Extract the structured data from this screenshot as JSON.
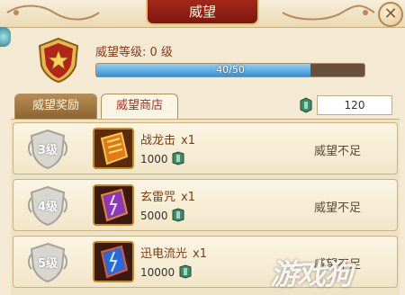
{
  "window": {
    "title": "威望"
  },
  "reputation": {
    "level_label": "威望等级:",
    "level_value": "0 级",
    "progress_text": "40/50",
    "progress_current": 40,
    "progress_max": 50
  },
  "tabs": [
    {
      "label": "威望奖励",
      "active": false
    },
    {
      "label": "威望商店",
      "active": true
    }
  ],
  "currency": {
    "icon": "jade-coin-icon",
    "amount": "120"
  },
  "shop_items": [
    {
      "level": "3级",
      "name": "战龙击",
      "qty": "x1",
      "price": "1000",
      "status": "威望不足",
      "icon": "orange-skill-book-icon"
    },
    {
      "level": "4级",
      "name": "玄雷咒",
      "qty": "x1",
      "price": "5000",
      "status": "威望不足",
      "icon": "purple-lightning-book-icon"
    },
    {
      "level": "5级",
      "name": "迅电流光",
      "qty": "x1",
      "price": "10000",
      "status": "威望不足",
      "icon": "blue-lightning-book-icon"
    }
  ],
  "watermark": "游戏狗",
  "colors": {
    "accent_red": "#a4271b",
    "progress_blue": "#3a8fd0",
    "gold_border": "#c58a1e"
  }
}
